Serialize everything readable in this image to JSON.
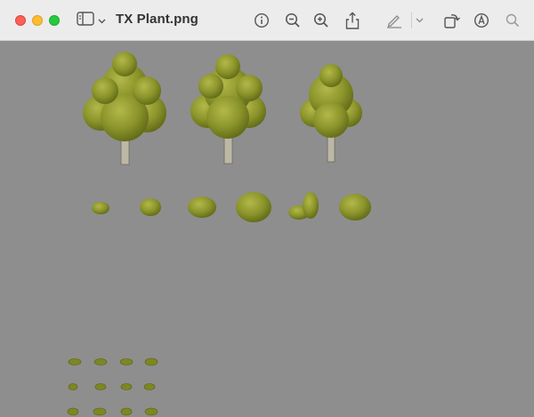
{
  "window": {
    "title": "TX Plant.png",
    "controls": [
      "close",
      "minimize",
      "zoom"
    ]
  },
  "toolbar": {
    "left": [
      {
        "name": "sidebar-toggle-icon"
      },
      {
        "name": "sidebar-menu-chevron-icon"
      }
    ],
    "right": [
      {
        "name": "info-icon"
      },
      {
        "name": "zoom-out-icon"
      },
      {
        "name": "zoom-in-icon"
      },
      {
        "name": "share-icon"
      },
      {
        "name": "highlight-pen-icon"
      },
      {
        "name": "highlight-menu-chevron-icon"
      },
      {
        "name": "rotate-icon"
      },
      {
        "name": "markup-icon"
      },
      {
        "name": "search-icon"
      }
    ]
  },
  "image": {
    "background": "#8e8e8e",
    "foliage_colors": [
      "#6f7a1a",
      "#8f9a2c",
      "#a7ae3f",
      "#5a6414"
    ],
    "trunk_color": "#bdb9a6",
    "rows": [
      "trees",
      "bushes",
      "small-sprouts"
    ]
  }
}
